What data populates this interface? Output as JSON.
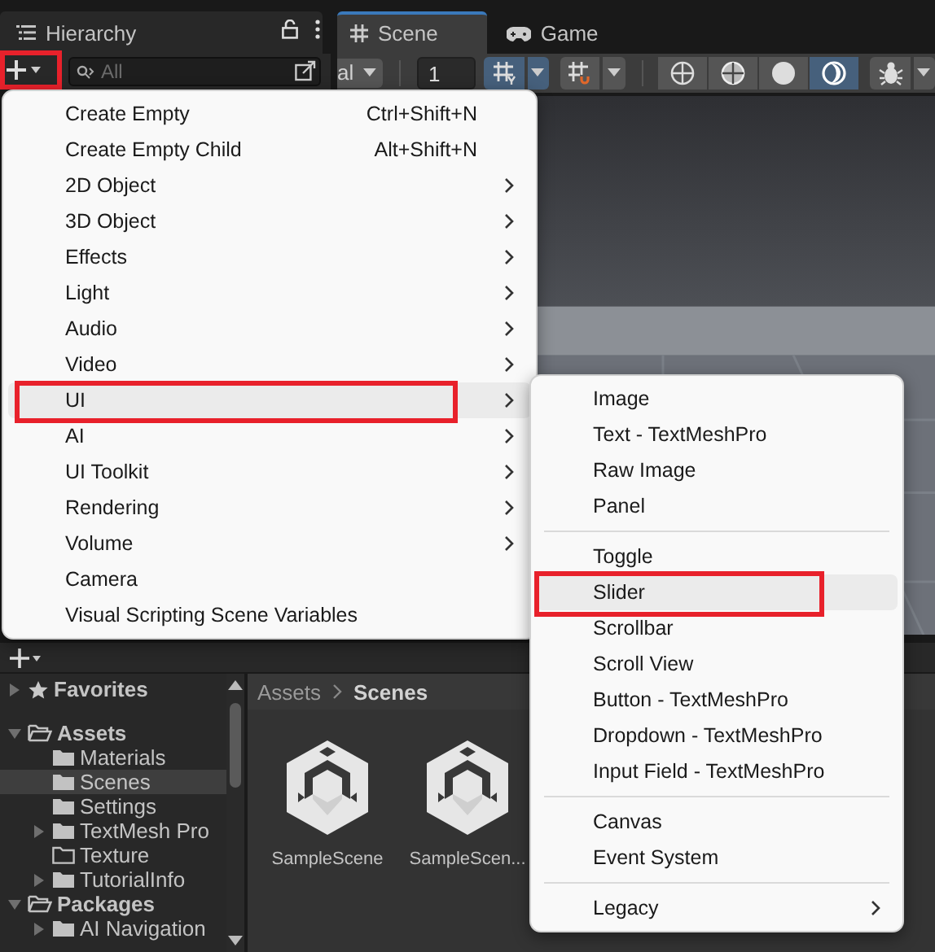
{
  "hierarchy": {
    "title": "Hierarchy",
    "add_button": {
      "outlined": true
    },
    "search": {
      "placeholder": "All"
    }
  },
  "scene_view": {
    "tabs": [
      {
        "title": "Scene",
        "kind": "scene",
        "selected": true
      },
      {
        "title": "Game",
        "kind": "game",
        "selected": false
      }
    ],
    "toolbar": {
      "draw_mode": "al",
      "grid_size": "1",
      "grid_on": true,
      "shading": [
        {
          "kind": "wireframe",
          "selected": false
        },
        {
          "kind": "shaded-wireframe",
          "selected": false
        },
        {
          "kind": "shaded",
          "selected": false
        },
        {
          "kind": "lit",
          "selected": true
        }
      ]
    }
  },
  "create_menu": {
    "items": [
      {
        "kind": "item",
        "label": "Create Empty",
        "shortcut": "Ctrl+Shift+N",
        "submenu": false,
        "selected": false,
        "outlined": false
      },
      {
        "kind": "item",
        "label": "Create Empty Child",
        "shortcut": "Alt+Shift+N",
        "submenu": false,
        "selected": false,
        "outlined": false
      },
      {
        "kind": "item",
        "label": "2D Object",
        "submenu": true,
        "selected": false,
        "outlined": false
      },
      {
        "kind": "item",
        "label": "3D Object",
        "submenu": true,
        "selected": false,
        "outlined": false
      },
      {
        "kind": "item",
        "label": "Effects",
        "submenu": true,
        "selected": false,
        "outlined": false
      },
      {
        "kind": "item",
        "label": "Light",
        "submenu": true,
        "selected": false,
        "outlined": false
      },
      {
        "kind": "item",
        "label": "Audio",
        "submenu": true,
        "selected": false,
        "outlined": false
      },
      {
        "kind": "item",
        "label": "Video",
        "submenu": true,
        "selected": false,
        "outlined": false
      },
      {
        "kind": "item",
        "label": "UI",
        "submenu": true,
        "selected": true,
        "outlined": true
      },
      {
        "kind": "item",
        "label": "AI",
        "submenu": true,
        "selected": false,
        "outlined": false
      },
      {
        "kind": "item",
        "label": "UI Toolkit",
        "submenu": true,
        "selected": false,
        "outlined": false
      },
      {
        "kind": "item",
        "label": "Rendering",
        "submenu": true,
        "selected": false,
        "outlined": false
      },
      {
        "kind": "item",
        "label": "Volume",
        "submenu": true,
        "selected": false,
        "outlined": false
      },
      {
        "kind": "item",
        "label": "Camera",
        "submenu": false,
        "selected": false,
        "outlined": false
      },
      {
        "kind": "item",
        "label": "Visual Scripting Scene Variables",
        "submenu": false,
        "selected": false,
        "outlined": false
      }
    ]
  },
  "ui_submenu": {
    "items": [
      {
        "kind": "item",
        "label": "Image",
        "submenu": false,
        "selected": false,
        "outlined": false
      },
      {
        "kind": "item",
        "label": "Text - TextMeshPro",
        "submenu": false,
        "selected": false,
        "outlined": false
      },
      {
        "kind": "item",
        "label": "Raw Image",
        "submenu": false,
        "selected": false,
        "outlined": false
      },
      {
        "kind": "item",
        "label": "Panel",
        "submenu": false,
        "selected": false,
        "outlined": false
      },
      {
        "kind": "separator"
      },
      {
        "kind": "item",
        "label": "Toggle",
        "submenu": false,
        "selected": false,
        "outlined": false
      },
      {
        "kind": "item",
        "label": "Slider",
        "submenu": false,
        "selected": true,
        "outlined": true
      },
      {
        "kind": "item",
        "label": "Scrollbar",
        "submenu": false,
        "selected": false,
        "outlined": false
      },
      {
        "kind": "item",
        "label": "Scroll View",
        "submenu": false,
        "selected": false,
        "outlined": false
      },
      {
        "kind": "item",
        "label": "Button - TextMeshPro",
        "submenu": false,
        "selected": false,
        "outlined": false
      },
      {
        "kind": "item",
        "label": "Dropdown - TextMeshPro",
        "submenu": false,
        "selected": false,
        "outlined": false
      },
      {
        "kind": "item",
        "label": "Input Field - TextMeshPro",
        "submenu": false,
        "selected": false,
        "outlined": false
      },
      {
        "kind": "separator"
      },
      {
        "kind": "item",
        "label": "Canvas",
        "submenu": false,
        "selected": false,
        "outlined": false
      },
      {
        "kind": "item",
        "label": "Event System",
        "submenu": false,
        "selected": false,
        "outlined": false
      },
      {
        "kind": "separator"
      },
      {
        "kind": "item",
        "label": "Legacy",
        "submenu": true,
        "selected": false,
        "outlined": false
      }
    ]
  },
  "project": {
    "tree": [
      {
        "label": "Favorites",
        "kind": "favorites",
        "expanded": false,
        "selected": false
      },
      {
        "label": "Assets",
        "kind": "folder",
        "expanded": true,
        "selected": false,
        "children": [
          {
            "label": "Materials",
            "kind": "folder",
            "selected": false
          },
          {
            "label": "Scenes",
            "kind": "folder",
            "selected": true
          },
          {
            "label": "Settings",
            "kind": "folder",
            "selected": false
          },
          {
            "label": "TextMesh Pro",
            "kind": "folder",
            "expanded": false,
            "selected": false
          },
          {
            "label": "Texture",
            "kind": "empty-folder",
            "selected": false
          },
          {
            "label": "TutorialInfo",
            "kind": "folder",
            "expanded": false,
            "selected": false
          }
        ]
      },
      {
        "label": "Packages",
        "kind": "folder",
        "expanded": true,
        "selected": false,
        "children": [
          {
            "label": "AI Navigation",
            "kind": "folder",
            "expanded": false,
            "selected": false
          }
        ]
      }
    ],
    "breadcrumb": [
      "Assets",
      "Scenes"
    ],
    "assets": [
      {
        "name": "SampleScene"
      },
      {
        "name": "SampleScen..."
      }
    ]
  }
}
